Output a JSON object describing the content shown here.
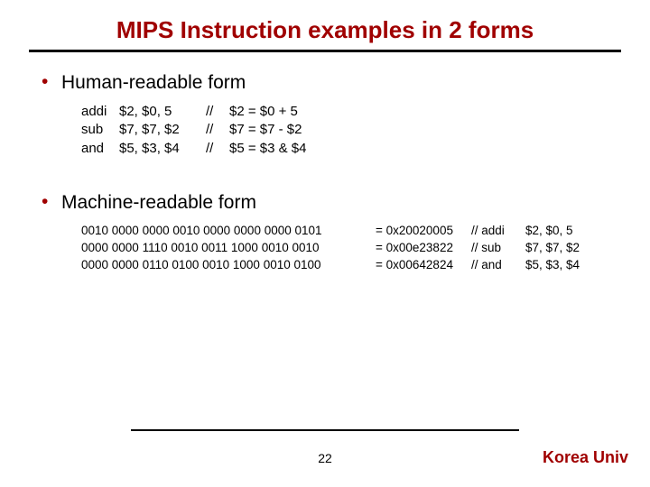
{
  "title": "MIPS Instruction examples in 2 forms",
  "sections": {
    "human": {
      "heading": "Human-readable form",
      "rows": [
        {
          "mnemonic": "addi",
          "args": "$2, $0, 5",
          "sep": "//",
          "comment": "$2 = $0 + 5"
        },
        {
          "mnemonic": "sub",
          "args": "$7, $7, $2",
          "sep": "//",
          "comment": "$7 = $7 - $2"
        },
        {
          "mnemonic": "and",
          "args": "$5, $3, $4",
          "sep": "//",
          "comment": "$5 = $3 & $4"
        }
      ]
    },
    "machine": {
      "heading": "Machine-readable form",
      "rows": [
        {
          "bin": "0010 0000 0000 0010 0000 0000 0000 0101",
          "hex": "= 0x20020005",
          "sep": "// addi",
          "args": "$2, $0, 5"
        },
        {
          "bin": "0000 0000 1110 0010 0011 1000 0010 0010",
          "hex": "= 0x00e23822",
          "sep": "// sub",
          "args": "$7, $7, $2"
        },
        {
          "bin": "0000 0000 0110 0100 0010 1000 0010 0100",
          "hex": "= 0x00642824",
          "sep": "// and",
          "args": "$5, $3, $4"
        }
      ]
    }
  },
  "page_number": "22",
  "footer": "Korea Univ"
}
